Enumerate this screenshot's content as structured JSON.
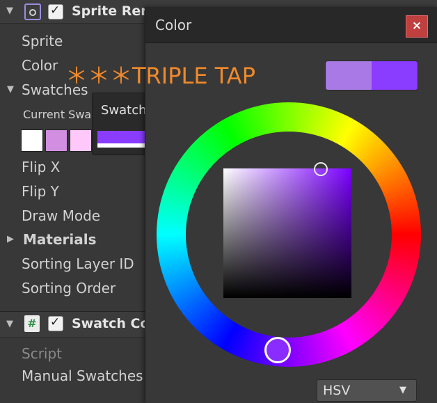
{
  "inspector": {
    "sprite_renderer": {
      "title": "Sprite Ren",
      "fold_glyph": "▼",
      "check_glyph": "✓",
      "rows": {
        "sprite": "Sprite",
        "color": "Color",
        "swatches": "Swatches",
        "current_swatch": "Current Swa",
        "flip_x": "Flip X",
        "flip_y": "Flip Y",
        "draw_mode": "Draw Mode",
        "materials": "Materials",
        "sorting_layer_id": "Sorting Layer ID",
        "sorting_order": "Sorting Order"
      },
      "swatches_fold_glyph": "▼",
      "materials_fold_glyph": "▶",
      "swatch_colors": [
        "#ffffff",
        "#d28ee0",
        "#ffc8fa",
        "#8a3cff"
      ]
    },
    "swatch_component": {
      "title": "Swatch Co",
      "fold_glyph": "▼",
      "check_glyph": "✓",
      "icon_glyph": "#",
      "rows": {
        "script": "Script",
        "manual_swatches": "Manual Swatches"
      }
    }
  },
  "tooltip": {
    "title": "Swatch",
    "swatch_color": "#8a3cff"
  },
  "annotation": {
    "text": "＊＊＊TRIPLE TAP",
    "color": "#f08a2b"
  },
  "color_window": {
    "title": "Color",
    "close_glyph": "×",
    "preview": {
      "old_color": "#a97ae6",
      "new_color": "#8a3cff"
    },
    "mode": {
      "selected": "HSV",
      "arrow_glyph": "▼"
    },
    "accent_color": "#c0403f"
  }
}
